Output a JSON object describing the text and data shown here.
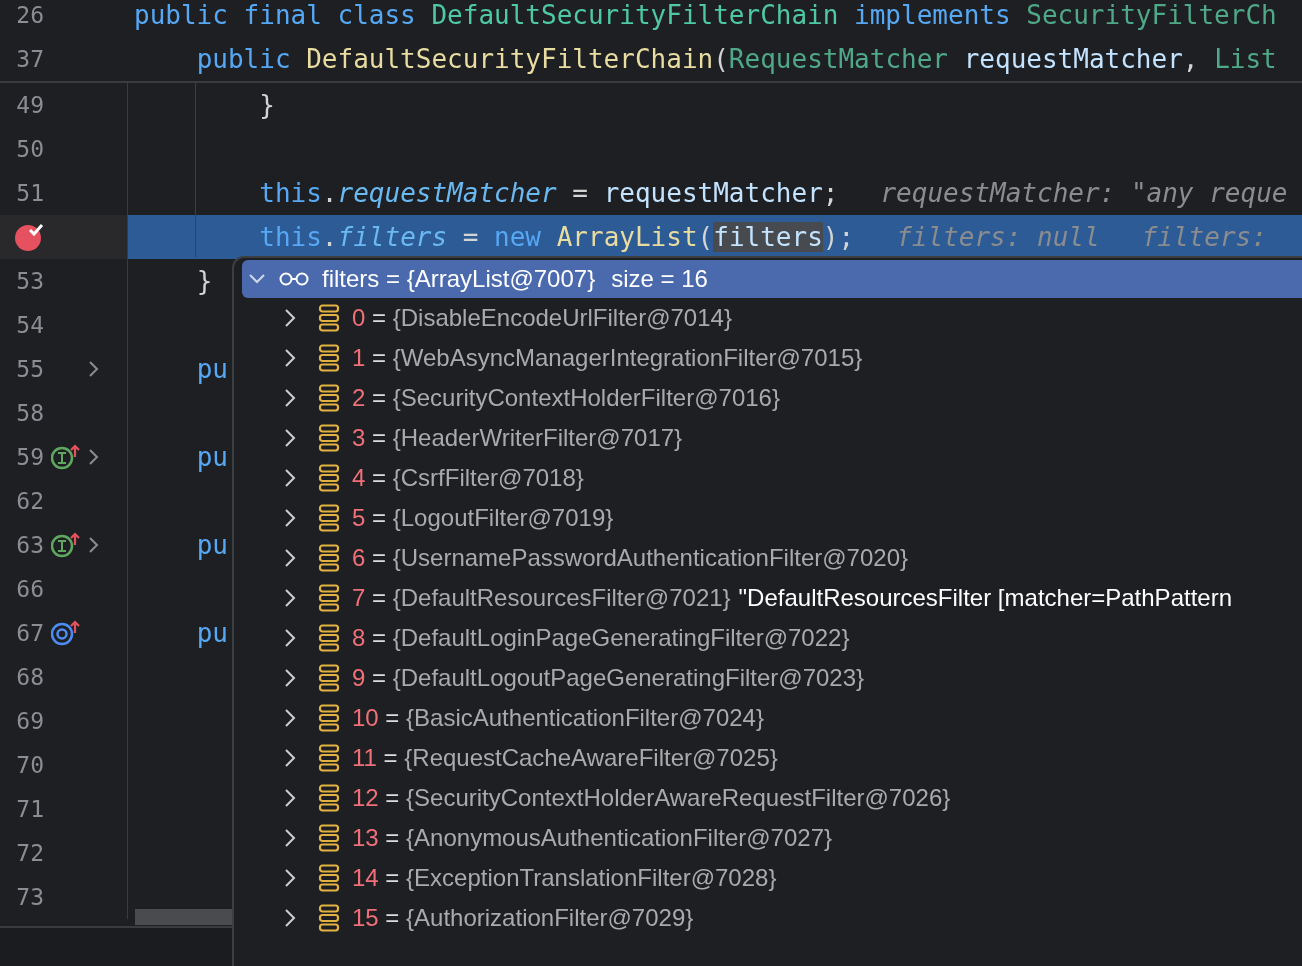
{
  "sticky_lines": [
    {
      "number": "26",
      "tokens": [
        {
          "kind": "kw",
          "text": "public final class "
        },
        {
          "kind": "decl",
          "text": "DefaultSecurityFilterChain "
        },
        {
          "kind": "kw",
          "text": "implements "
        },
        {
          "kind": "type",
          "text": "SecurityFilterCh"
        }
      ]
    },
    {
      "number": "37",
      "tokens": [
        {
          "kind": "kw",
          "text": "    public "
        },
        {
          "kind": "method",
          "text": "DefaultSecurityFilterChain"
        },
        {
          "kind": "punct",
          "text": "("
        },
        {
          "kind": "type",
          "text": "RequestMatcher "
        },
        {
          "kind": "param",
          "text": "requestMatcher"
        },
        {
          "kind": "punct",
          "text": ", "
        },
        {
          "kind": "type",
          "text": "List"
        }
      ]
    }
  ],
  "lines": [
    {
      "number": "49",
      "breakpoint": false,
      "current": false,
      "folded": false,
      "tokens": [
        {
          "kind": "punct",
          "text": "        }"
        }
      ]
    },
    {
      "number": "50",
      "breakpoint": false,
      "current": false,
      "folded": false
    },
    {
      "number": "51",
      "breakpoint": false,
      "current": false,
      "folded": false,
      "tokens": [
        {
          "kind": "kw",
          "text": "        this"
        },
        {
          "kind": "punct",
          "text": "."
        },
        {
          "kind": "field",
          "text": "requestMatcher"
        },
        {
          "kind": "punct",
          "text": " = "
        },
        {
          "kind": "param",
          "text": "requestMatcher"
        },
        {
          "kind": "punct",
          "text": ";"
        }
      ],
      "hints": [
        "requestMatcher: \"any reque"
      ]
    },
    {
      "breakpoint": true,
      "current": true,
      "folded": false,
      "tokens": [
        {
          "kind": "kw",
          "text": "        this"
        },
        {
          "kind": "punct",
          "text": "."
        },
        {
          "kind": "field",
          "text": "filters"
        },
        {
          "kind": "punct",
          "text": " = "
        },
        {
          "kind": "kw",
          "text": "new "
        },
        {
          "kind": "method",
          "text": "ArrayList"
        },
        {
          "kind": "punct",
          "text": "("
        },
        {
          "kind": "usage",
          "text": "filters"
        },
        {
          "kind": "punct",
          "text": ");"
        }
      ],
      "hints": [
        "filters: null",
        "filters:"
      ]
    },
    {
      "number": "53",
      "breakpoint": false,
      "current": false,
      "folded": false,
      "tokens": [
        {
          "kind": "punct",
          "text": "    }"
        }
      ]
    },
    {
      "number": "54",
      "breakpoint": false,
      "current": false,
      "folded": false
    },
    {
      "number": "55",
      "breakpoint": false,
      "current": false,
      "folded": true,
      "tokens": [
        {
          "kind": "kw",
          "text": "    pu"
        }
      ]
    },
    {
      "number": "58",
      "breakpoint": false,
      "current": false,
      "folded": false
    },
    {
      "number": "59",
      "breakpoint": false,
      "current": false,
      "folded": true,
      "kind": "implements",
      "tokens": [
        {
          "kind": "kw",
          "text": "    pu"
        }
      ]
    },
    {
      "number": "62",
      "breakpoint": false,
      "current": false,
      "folded": false
    },
    {
      "number": "63",
      "breakpoint": false,
      "current": false,
      "folded": true,
      "kind": "implements",
      "tokens": [
        {
          "kind": "kw",
          "text": "    pu"
        }
      ]
    },
    {
      "number": "66",
      "breakpoint": false,
      "current": false,
      "folded": false
    },
    {
      "number": "67",
      "breakpoint": false,
      "current": false,
      "folded": false,
      "kind": "overrides",
      "tokens": [
        {
          "kind": "kw",
          "text": "    pu"
        }
      ]
    },
    {
      "number": "68",
      "breakpoint": false,
      "current": false,
      "folded": false
    },
    {
      "number": "69",
      "breakpoint": false,
      "current": false,
      "folded": false
    },
    {
      "number": "70",
      "breakpoint": false,
      "current": false,
      "folded": false
    },
    {
      "number": "71",
      "breakpoint": false,
      "current": false,
      "folded": false
    },
    {
      "number": "72",
      "breakpoint": false,
      "current": false,
      "folded": false
    },
    {
      "number": "73",
      "breakpoint": false,
      "current": false,
      "folded": false
    }
  ],
  "popup": {
    "expanded": true,
    "label": "filters = {ArrayList@7007}",
    "size": "size = 16",
    "items": [
      {
        "index": "0",
        "op": "=",
        "value": "{DisableEncodeUrlFilter@7014}"
      },
      {
        "index": "1",
        "op": "=",
        "value": "{WebAsyncManagerIntegrationFilter@7015}"
      },
      {
        "index": "2",
        "op": "=",
        "value": "{SecurityContextHolderFilter@7016}"
      },
      {
        "index": "3",
        "op": "=",
        "value": "{HeaderWriterFilter@7017}"
      },
      {
        "index": "4",
        "op": "=",
        "value": "{CsrfFilter@7018}"
      },
      {
        "index": "5",
        "op": "=",
        "value": "{LogoutFilter@7019}"
      },
      {
        "index": "6",
        "op": "=",
        "value": "{UsernamePasswordAuthenticationFilter@7020}"
      },
      {
        "index": "7",
        "op": "=",
        "value": "{DefaultResourcesFilter@7021}",
        "text": "\"DefaultResourcesFilter [matcher=PathPattern"
      },
      {
        "index": "8",
        "op": "=",
        "value": "{DefaultLoginPageGeneratingFilter@7022}"
      },
      {
        "index": "9",
        "op": "=",
        "value": "{DefaultLogoutPageGeneratingFilter@7023}"
      },
      {
        "index": "10",
        "op": "=",
        "value": "{BasicAuthenticationFilter@7024}"
      },
      {
        "index": "11",
        "op": "=",
        "value": "{RequestCacheAwareFilter@7025}"
      },
      {
        "index": "12",
        "op": "=",
        "value": "{SecurityContextHolderAwareRequestFilter@7026}"
      },
      {
        "index": "13",
        "op": "=",
        "value": "{AnonymousAuthenticationFilter@7027}"
      },
      {
        "index": "14",
        "op": "=",
        "value": "{ExceptionTranslationFilter@7028}"
      },
      {
        "index": "15",
        "op": "=",
        "value": "{AuthorizationFilter@7029}"
      }
    ]
  }
}
